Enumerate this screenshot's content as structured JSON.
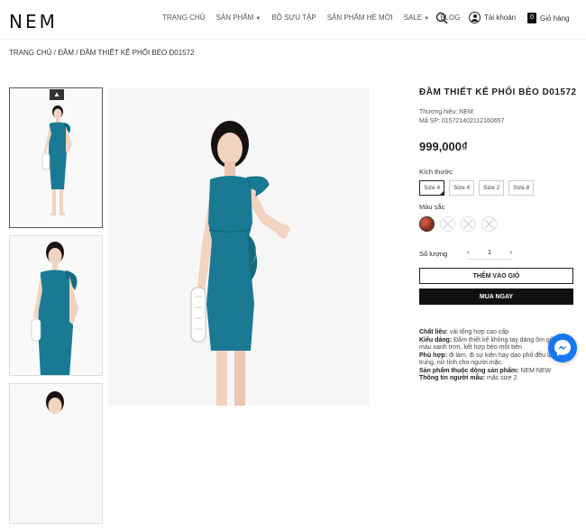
{
  "header": {
    "logo": "NEM",
    "nav": [
      {
        "label": "Trang chủ",
        "dropdown": false
      },
      {
        "label": "Sản phẩm",
        "dropdown": true
      },
      {
        "label": "Bộ sưu tập",
        "dropdown": false
      },
      {
        "label": "Sản phẩm hè mới",
        "dropdown": false
      },
      {
        "label": "Sale",
        "dropdown": true
      },
      {
        "label": "Blog",
        "dropdown": false
      }
    ],
    "account_label": "Tài khoản",
    "cart_count": "0",
    "cart_label": "Giỏ hàng"
  },
  "breadcrumb": "TRANG CHỦ / ĐẦM / ĐẦM THIẾT KẾ PHỐI BÈO D01572",
  "product": {
    "title": "ĐẦM THIẾT KẾ PHỐI BÈO D01572",
    "brand": "Thương hiệu: NEM",
    "sku": "Mã SP: 015721402112160657",
    "price": "999,000₫",
    "size_label": "Kích thước",
    "sizes": [
      "Size 4",
      "Size 4",
      "Size 2",
      "Size 8"
    ],
    "selected_size": "Size 4",
    "color_label": "Màu sắc",
    "qty_label": "Số lượng",
    "qty_value": "1",
    "add_to_cart": "THÊM VÀO GIỎ",
    "buy_now": "MUA NGAY",
    "description": {
      "material_label": "Chất liệu:",
      "material": " vải tổng hợp cao cấp",
      "style_label": "Kiểu dáng:",
      "style": " Đầm thiết kế không tay dáng ôm gối tone màu xanh trơn, kết hợp bèo một bên",
      "fit_label": "Phù hợp:",
      "fit": " đi làm, đi sự kiện hay dạo phố đều tạo vẻ trẻ trung, nữ tính cho người mặc.",
      "line_label": "Sản phẩm thuộc dòng sản phẩm:",
      "line": " NEM NEW",
      "model_label": "Thông tin người mẫu:",
      "model": " mặc size 2"
    }
  },
  "colors": {
    "dress": "#1a7a94",
    "skin": "#f1d3c0",
    "hair": "#161212"
  }
}
